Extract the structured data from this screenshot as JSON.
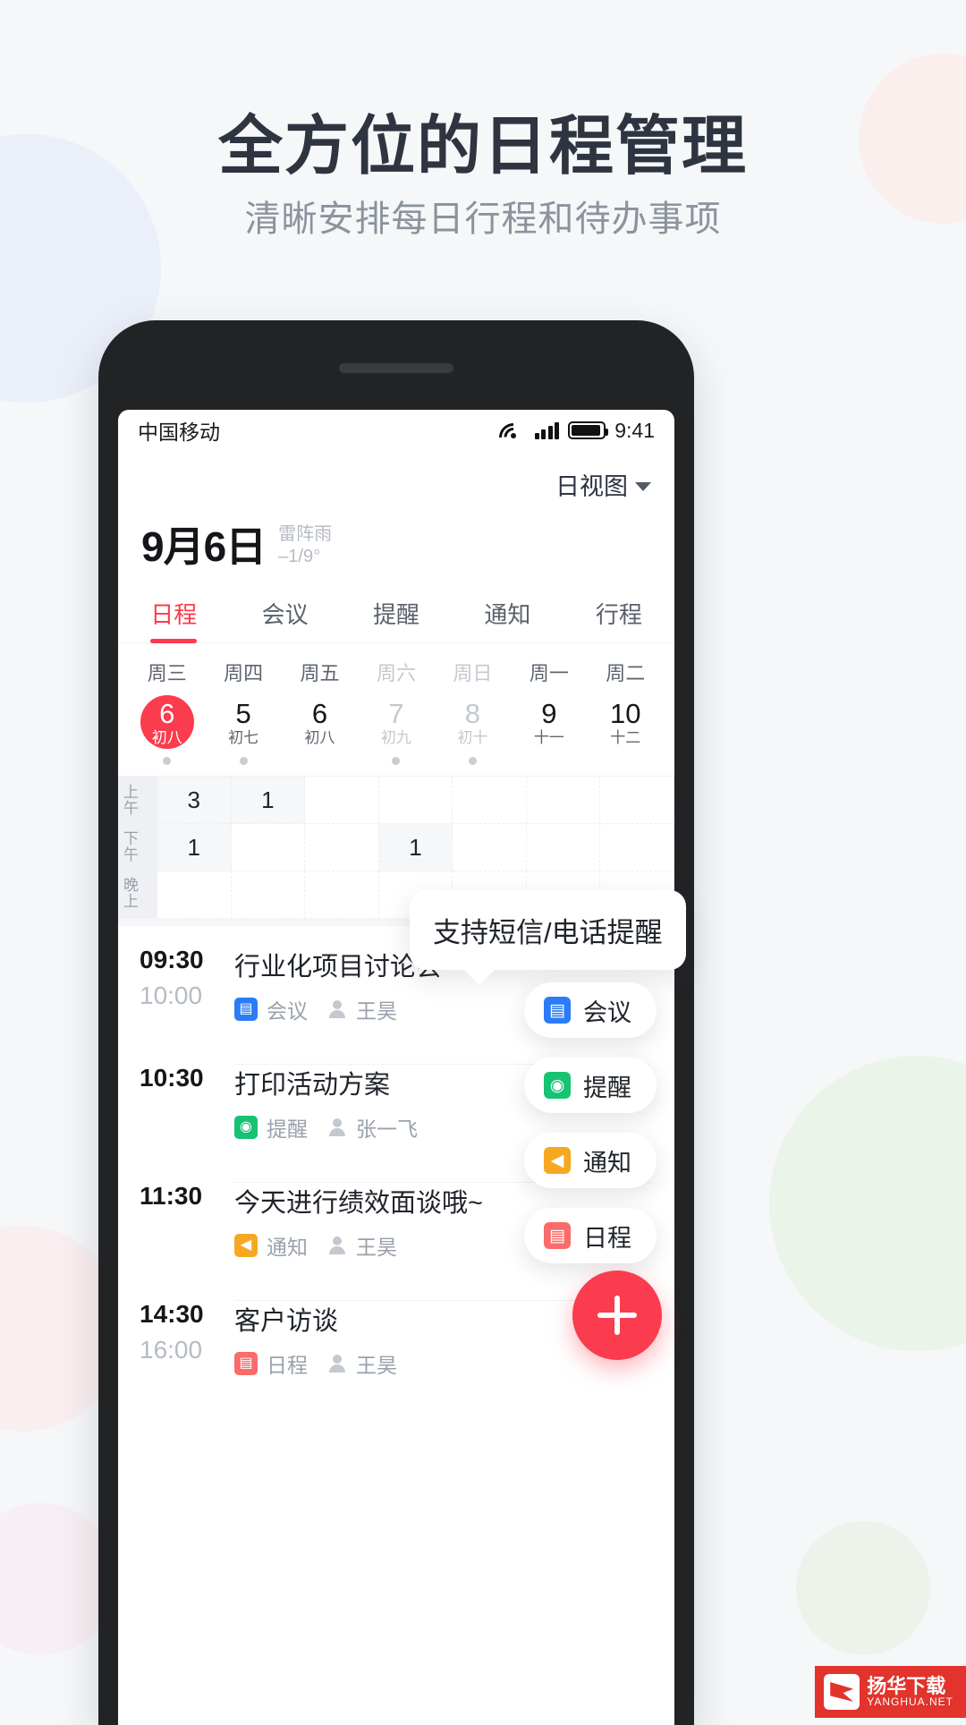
{
  "page": {
    "headline": "全方位的日程管理",
    "subhead": "清晰安排每日行程和待办事项"
  },
  "statusbar": {
    "carrier": "中国移动",
    "time": "9:41",
    "icons": [
      "wifi-icon",
      "signal-icon",
      "battery-icon"
    ]
  },
  "header": {
    "view_switch": "日视图",
    "date": "9月6日",
    "weather_desc": "雷阵雨",
    "weather_temp": "–1/9°"
  },
  "tabs": [
    {
      "label": "日程",
      "active": true
    },
    {
      "label": "会议",
      "active": false
    },
    {
      "label": "提醒",
      "active": false
    },
    {
      "label": "通知",
      "active": false
    },
    {
      "label": "行程",
      "active": false
    }
  ],
  "week": [
    {
      "dow": "周三",
      "num": "6",
      "lunar": "初八",
      "today": true,
      "weekend": false,
      "dot": true
    },
    {
      "dow": "周四",
      "num": "5",
      "lunar": "初七",
      "today": false,
      "weekend": false,
      "dot": true
    },
    {
      "dow": "周五",
      "num": "6",
      "lunar": "初八",
      "today": false,
      "weekend": false,
      "dot": false
    },
    {
      "dow": "周六",
      "num": "7",
      "lunar": "初九",
      "today": false,
      "weekend": true,
      "dot": true
    },
    {
      "dow": "周日",
      "num": "8",
      "lunar": "初十",
      "today": false,
      "weekend": true,
      "dot": true
    },
    {
      "dow": "周一",
      "num": "9",
      "lunar": "十一",
      "today": false,
      "weekend": false,
      "dot": false
    },
    {
      "dow": "周二",
      "num": "10",
      "lunar": "十二",
      "today": false,
      "weekend": false,
      "dot": false
    }
  ],
  "grid": {
    "row_labels": [
      "上午",
      "下午",
      "晚上"
    ],
    "rows": [
      [
        "3",
        "1",
        "",
        "",
        "",
        "",
        ""
      ],
      [
        "1",
        "",
        "",
        "1",
        "",
        "",
        ""
      ],
      [
        "",
        "",
        "",
        "",
        "",
        "",
        ""
      ]
    ]
  },
  "events": [
    {
      "start": "09:30",
      "end": "10:00",
      "title": "行业化项目讨论会",
      "tag": "会议",
      "tag_color": "#2b7cf6",
      "tag_glyph": "▤",
      "person": "王昊"
    },
    {
      "start": "10:30",
      "end": "",
      "title": "打印活动方案",
      "tag": "提醒",
      "tag_color": "#17c272",
      "tag_glyph": "◉",
      "person": "张一飞"
    },
    {
      "start": "11:30",
      "end": "",
      "title": "今天进行绩效面谈哦~",
      "tag": "通知",
      "tag_color": "#f7a823",
      "tag_glyph": "◀",
      "person": "王昊"
    },
    {
      "start": "14:30",
      "end": "16:00",
      "title": "客户访谈",
      "tag": "日程",
      "tag_color": "#fb6b6b",
      "tag_glyph": "▤",
      "person": "王昊"
    }
  ],
  "tooltip": {
    "text": "支持短信/电话提醒"
  },
  "chips": [
    {
      "label": "会议",
      "color": "#2b7cf6",
      "glyph": "▤"
    },
    {
      "label": "提醒",
      "color": "#17c272",
      "glyph": "◉"
    },
    {
      "label": "通知",
      "color": "#f7a823",
      "glyph": "◀"
    },
    {
      "label": "日程",
      "color": "#fb6b6b",
      "glyph": "▤"
    }
  ],
  "fab": {
    "label": "add-event"
  },
  "watermark": {
    "line1": "扬华下载",
    "line2": "YANGHUA.NET"
  },
  "colors": {
    "accent": "#fb3b4e",
    "page_bg": "#f5f7f9",
    "text_dark": "#20242a",
    "text_muted": "#9aa1ab"
  }
}
